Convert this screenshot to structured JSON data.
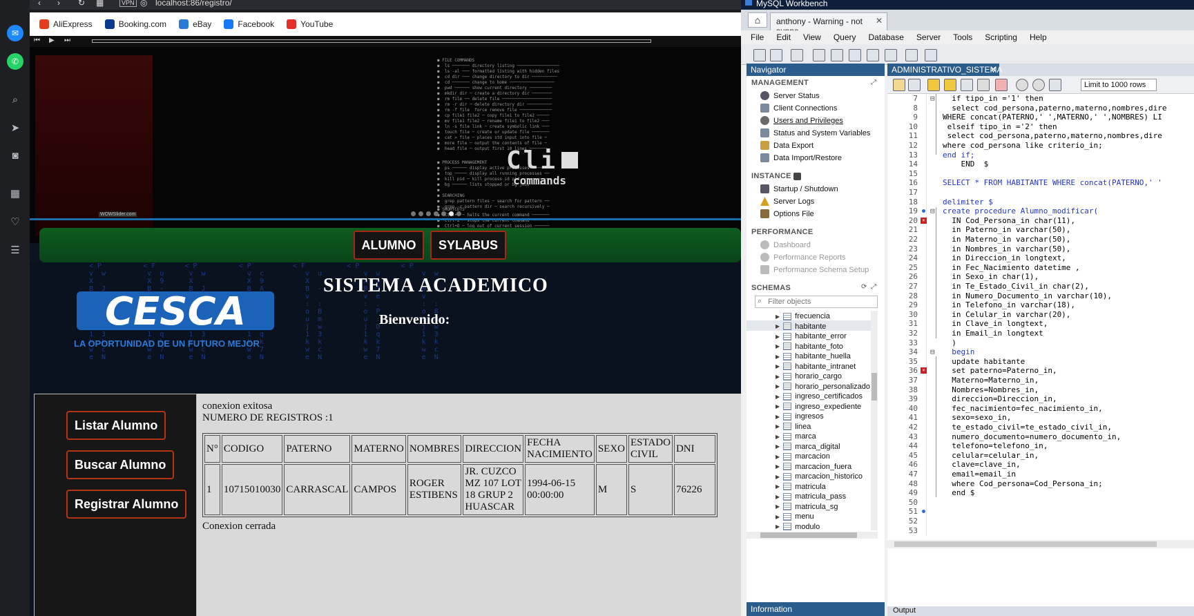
{
  "browser": {
    "vpn_label": "VPN",
    "url": "localhost:86/registro/",
    "bookmarks": [
      {
        "label": "AliExpress",
        "icon": "aliexpress-icon",
        "color": "#e53e1e"
      },
      {
        "label": "Booking.com",
        "icon": "booking-icon",
        "color": "#0a3a8c"
      },
      {
        "label": "eBay",
        "icon": "ebay-icon",
        "color": "#2a7bd6"
      },
      {
        "label": "Facebook",
        "icon": "facebook-icon",
        "color": "#1877f2"
      },
      {
        "label": "YouTube",
        "icon": "youtube-icon",
        "color": "#e52d27"
      }
    ]
  },
  "slider": {
    "cli_title": "Cli",
    "cli_sub": "commands",
    "watermark": "WOWSlider.com"
  },
  "menu": {
    "alumno": "ALUMNO",
    "sylabus": "SYLABUS"
  },
  "hero": {
    "logo_text": "CESCA",
    "tagline": "LA OPORTUNIDAD DE UN FUTURO MEJOR",
    "title": "SISTEMA ACADEMICO",
    "welcome": "Bienvenido:"
  },
  "left_menu": {
    "listar": "Listar Alumno",
    "buscar": "Buscar Alumno",
    "registrar": "Registrar Alumno"
  },
  "content": {
    "status": "conexion exitosa",
    "count": "NUMERO DE REGISTROS :1",
    "closed": "Conexion cerrada",
    "headers": [
      "N°",
      "CODIGO",
      "PATERNO",
      "MATERNO",
      "NOMBRES",
      "DIRECCION",
      "FECHA NACIMIENTO",
      "SEXO",
      "ESTADO CIVIL",
      "DNI"
    ],
    "row": [
      "1",
      "10715010030",
      "CARRASCAL",
      "CAMPOS",
      "ROGER ESTIBENS",
      "JR. CUZCO MZ 107 LOT 18 GRUP 2 HUASCAR",
      "1994-06-15 00:00:00",
      "M",
      "S",
      "76226"
    ]
  },
  "workbench": {
    "title": "MySQL Workbench",
    "tab": "anthony - Warning - not suppo...",
    "menu": [
      "File",
      "Edit",
      "View",
      "Query",
      "Database",
      "Server",
      "Tools",
      "Scripting",
      "Help"
    ],
    "navigator": {
      "header": "Navigator",
      "management": "MANAGEMENT",
      "management_items": [
        "Server Status",
        "Client Connections",
        "Users and Privileges",
        "Status and System Variables",
        "Data Export",
        "Data Import/Restore"
      ],
      "instance": "INSTANCE",
      "instance_items": [
        "Startup / Shutdown",
        "Server Logs",
        "Options File"
      ],
      "performance": "PERFORMANCE",
      "performance_items": [
        "Dashboard",
        "Performance Reports",
        "Performance Schema Setup"
      ],
      "schemas": "SCHEMAS",
      "filter_placeholder": "Filter objects",
      "tables": [
        "frecuencia",
        "habitante",
        "habitante_error",
        "habitante_foto",
        "habitante_huella",
        "habitante_intranet",
        "horario_cargo",
        "horario_personalizado",
        "ingreso_certificados",
        "ingreso_expediente",
        "ingresos",
        "linea",
        "marca",
        "marca_digital",
        "marcacion",
        "marcacion_fuera",
        "marcacion_historico",
        "matricula",
        "matricula_pass",
        "matricula_sg",
        "menu",
        "modulo"
      ],
      "information": "Information"
    },
    "editor": {
      "tab": "ADMINISTRATIVO_SISTEMA",
      "limit": "Limit to 1000 rows",
      "output": "Output",
      "lines": [
        {
          "n": "7",
          "text": "  if tipo_in ='1' then"
        },
        {
          "n": "8",
          "text": "  select cod_persona,paterno,materno,nombres,dire"
        },
        {
          "n": "9",
          "text": "WHERE concat(PATERNO,' ',MATERNO,' ',NOMBRES) LI"
        },
        {
          "n": "10",
          "text": " elseif tipo_in ='2' then"
        },
        {
          "n": "11",
          "text": " select cod_persona,paterno,materno,nombres,dire"
        },
        {
          "n": "12",
          "text": "where cod_persona like criterio_in;"
        },
        {
          "n": "13",
          "text": "end if;"
        },
        {
          "n": "14",
          "text": "    END  $"
        },
        {
          "n": "15",
          "text": ""
        },
        {
          "n": "16",
          "text": "SELECT * FROM HABITANTE WHERE concat(PATERNO,' '"
        },
        {
          "n": "17",
          "text": ""
        },
        {
          "n": "18",
          "text": "delimiter $"
        },
        {
          "n": "19",
          "text": "create procedure Alumno_modificar("
        },
        {
          "n": "20",
          "text": "  IN Cod_Persona_in char(11),"
        },
        {
          "n": "21",
          "text": "  in Paterno_in varchar(50),"
        },
        {
          "n": "22",
          "text": "  in Materno_in varchar(50),"
        },
        {
          "n": "23",
          "text": "  in Nombres_in varchar(50),"
        },
        {
          "n": "24",
          "text": "  in Direccion_in longtext,"
        },
        {
          "n": "25",
          "text": "  in Fec_Nacimiento datetime ,"
        },
        {
          "n": "26",
          "text": "  in Sexo_in char(1),"
        },
        {
          "n": "27",
          "text": "  in Te_Estado_Civil_in char(2),"
        },
        {
          "n": "28",
          "text": "  in Numero_Documento_in varchar(10),"
        },
        {
          "n": "29",
          "text": "  in Telefono_in varchar(18),"
        },
        {
          "n": "30",
          "text": "  in Celular_in varchar(20),"
        },
        {
          "n": "31",
          "text": "  in Clave_in longtext,"
        },
        {
          "n": "32",
          "text": "  in Email_in longtext"
        },
        {
          "n": "33",
          "text": "  )"
        },
        {
          "n": "34",
          "text": "  begin"
        },
        {
          "n": "35",
          "text": "  update habitante"
        },
        {
          "n": "36",
          "text": "  set paterno=Paterno_in,"
        },
        {
          "n": "37",
          "text": "  Materno=Materno_in,"
        },
        {
          "n": "38",
          "text": "  Nombres=Nombres_in,"
        },
        {
          "n": "39",
          "text": "  direccion=Direccion_in,"
        },
        {
          "n": "40",
          "text": "  fec_nacimiento=fec_nacimiento_in,"
        },
        {
          "n": "41",
          "text": "  sexo=sexo_in,"
        },
        {
          "n": "42",
          "text": "  te_estado_civil=te_estado_civil_in,"
        },
        {
          "n": "43",
          "text": "  numero_documento=numero_documento_in,"
        },
        {
          "n": "44",
          "text": "  telefono=telefono_in,"
        },
        {
          "n": "45",
          "text": "  celular=celular_in,"
        },
        {
          "n": "46",
          "text": "  clave=clave_in,"
        },
        {
          "n": "47",
          "text": "  email=email_in"
        },
        {
          "n": "48",
          "text": "  where Cod_persona=Cod_Persona_in;"
        },
        {
          "n": "49",
          "text": "  end $"
        },
        {
          "n": "50",
          "text": ""
        },
        {
          "n": "51",
          "text": ""
        },
        {
          "n": "52",
          "text": ""
        },
        {
          "n": "53",
          "text": ""
        }
      ]
    }
  }
}
